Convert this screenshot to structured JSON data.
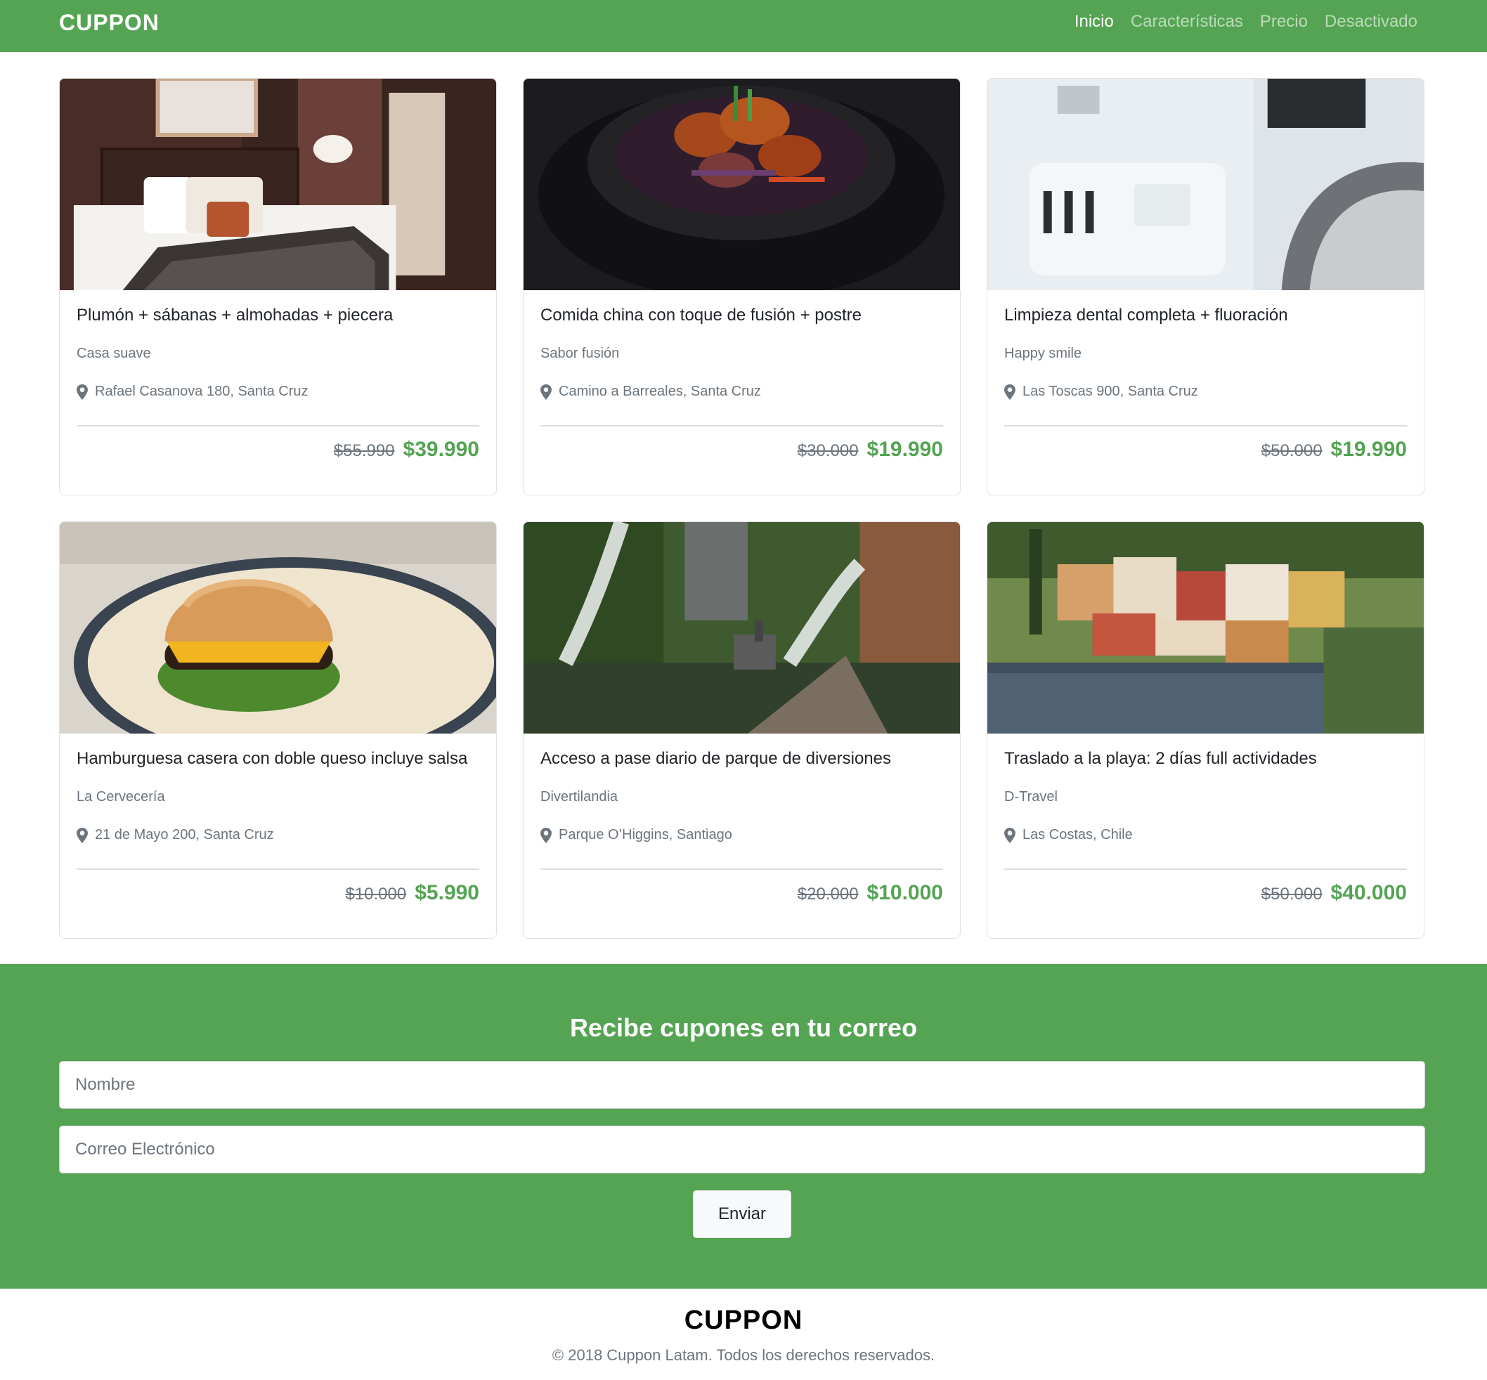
{
  "brand": "CUPPON",
  "nav": {
    "items": [
      {
        "label": "Inicio",
        "active": true
      },
      {
        "label": "Características",
        "active": false
      },
      {
        "label": "Precio",
        "active": false
      },
      {
        "label": "Desactivado",
        "active": false
      }
    ]
  },
  "colors": {
    "accent": "#54a453"
  },
  "cards": [
    {
      "title": "Plumón + sábanas + almohadas + piecera",
      "vendor": "Casa suave",
      "location": "Rafael Casanova 180, Santa Cruz",
      "old_price": "$55.990",
      "price": "$39.990",
      "image_icon": "bedroom-photo"
    },
    {
      "title": "Comida china con toque de fusión + postre",
      "vendor": "Sabor fusión",
      "location": "Camino a Barreales, Santa Cruz",
      "old_price": "$30.000",
      "price": "$19.990",
      "image_icon": "food-bowl-photo"
    },
    {
      "title": "Limpieza dental completa + fluoración",
      "vendor": "Happy smile",
      "location": "Las Toscas 900, Santa Cruz",
      "old_price": "$50.000",
      "price": "$19.990",
      "image_icon": "dental-chair-photo"
    },
    {
      "title": "Hamburguesa casera con doble queso incluye salsa",
      "vendor": "La Cervecería",
      "location": "21 de Mayo 200, Santa Cruz",
      "old_price": "$10.000",
      "price": "$5.990",
      "image_icon": "burger-photo"
    },
    {
      "title": "Acceso a pase diario de parque de diversiones",
      "vendor": "Divertilandia",
      "location": "Parque O’Higgins, Santiago",
      "old_price": "$20.000",
      "price": "$10.000",
      "image_icon": "theme-park-photo"
    },
    {
      "title": "Traslado a la playa: 2 días full actividades",
      "vendor": "D-Travel",
      "location": "Las Costas, Chile",
      "old_price": "$50.000",
      "price": "$40.000",
      "image_icon": "coastal-village-photo"
    }
  ],
  "newsletter": {
    "title": "Recibe cupones en tu correo",
    "name_placeholder": "Nombre",
    "email_placeholder": "Correo Electrónico",
    "submit_label": "Enviar"
  },
  "footer": {
    "brand": "CUPPON",
    "copyright": "© 2018 Cuppon Latam. Todos los derechos reservados."
  }
}
